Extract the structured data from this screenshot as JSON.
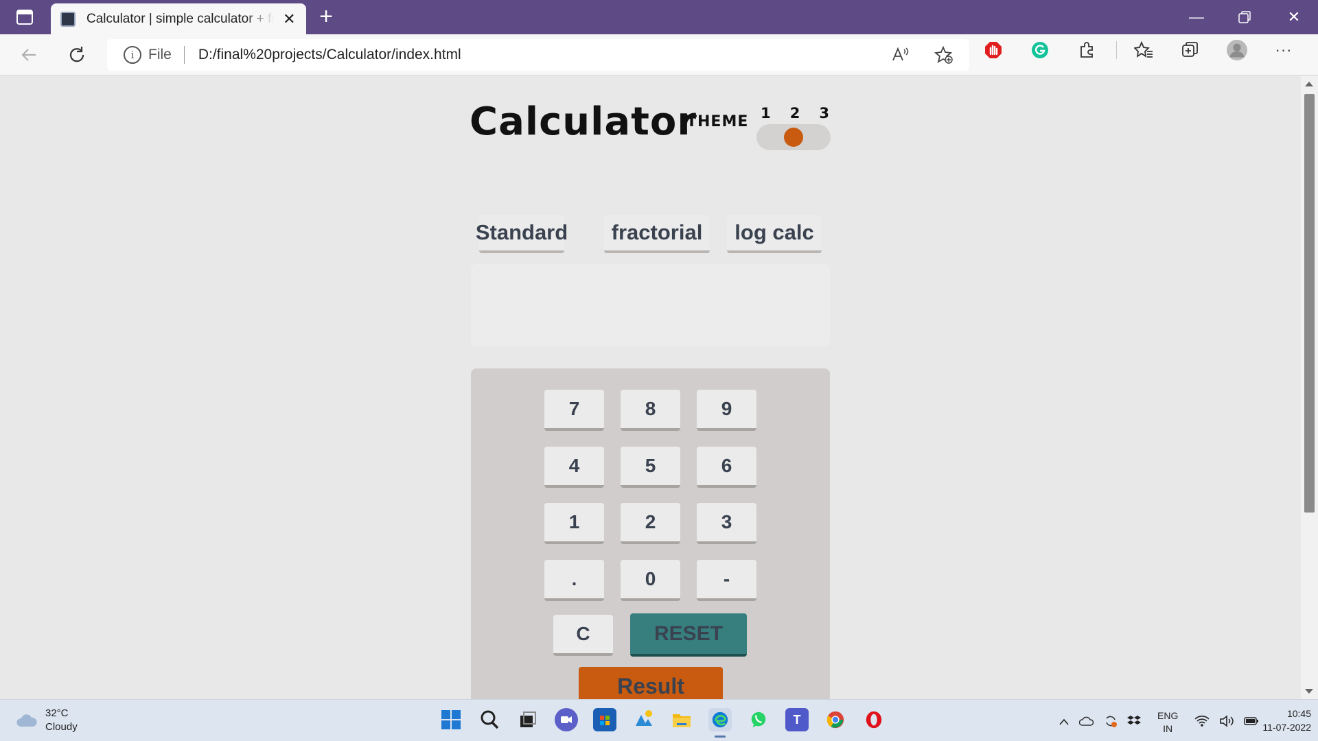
{
  "browser": {
    "tab_title": "Calculator | simple calculator + fractorial",
    "url_prefix": "File",
    "url": "D:/final%20projects/Calculator/index.html"
  },
  "page": {
    "title": "Calculator",
    "theme_label": "THEME",
    "theme_options": [
      "1",
      "2",
      "3"
    ],
    "theme_selected": "2",
    "theme_colors": {
      "knob": "#c85b10",
      "reset": "#377f7f",
      "result": "#c85b10"
    },
    "modes": [
      "Standard",
      "fractorial",
      "log calc"
    ],
    "display_value": "",
    "keys": [
      [
        "7",
        "8",
        "9"
      ],
      [
        "4",
        "5",
        "6"
      ],
      [
        "1",
        "2",
        "3"
      ],
      [
        ".",
        "0",
        "-"
      ]
    ],
    "clear_label": "C",
    "reset_label": "RESET",
    "result_label": "Result"
  },
  "taskbar": {
    "weather_temp": "32°C",
    "weather_desc": "Cloudy",
    "lang_top": "ENG",
    "lang_bottom": "IN",
    "time": "10:45",
    "date": "11-07-2022",
    "apps": [
      "start-icon",
      "search-icon",
      "task-view-icon",
      "teams-chat-icon",
      "store-icon",
      "photos-icon",
      "file-explorer-icon",
      "edge-icon",
      "whatsapp-icon",
      "teams-icon",
      "chrome-icon",
      "opera-icon"
    ]
  }
}
